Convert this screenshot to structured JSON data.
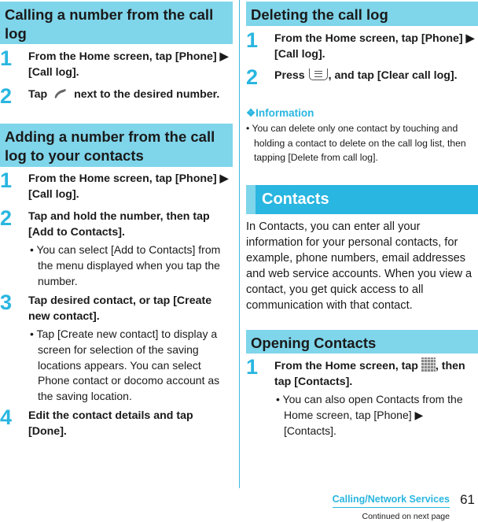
{
  "left": {
    "section1": {
      "title": "Calling a number from the call log",
      "steps": [
        {
          "num": "1",
          "text": "From the Home screen, tap [Phone] ▶ [Call log]."
        },
        {
          "num": "2",
          "text_before": "Tap",
          "icon": "phone-handset-icon",
          "text_after": "next to the desired number."
        }
      ]
    },
    "section2": {
      "title": "Adding a number from the call log to your contacts",
      "steps": [
        {
          "num": "1",
          "text": "From the Home screen, tap [Phone] ▶ [Call log]."
        },
        {
          "num": "2",
          "text": "Tap and hold the number, then tap [Add to Contacts].",
          "note": "You can select [Add to Contacts] from the menu displayed when you tap the number."
        },
        {
          "num": "3",
          "text": "Tap desired contact, or tap [Create new contact].",
          "note": "Tap [Create new contact] to display a screen for selection of the saving locations appears. You can select Phone contact or docomo account as the saving location."
        },
        {
          "num": "4",
          "text": "Edit the contact details and tap [Done]."
        }
      ]
    }
  },
  "right": {
    "section3": {
      "title": "Deleting the call log",
      "steps": [
        {
          "num": "1",
          "text": "From the Home screen, tap [Phone] ▶ [Call log]."
        },
        {
          "num": "2",
          "text_before": "Press",
          "icon": "menu-key-icon",
          "text_after": ", and tap [Clear call log]."
        }
      ],
      "info_title": "❖Information",
      "info_text": "You can delete only one contact by touching and holding a contact to delete on the call log list, then tapping [Delete from call log]."
    },
    "contacts": {
      "title": "Contacts",
      "paragraph": "In Contacts, you can enter all your information for your personal contacts, for example, phone numbers, email addresses and web service accounts. When you view a contact, you get quick access to all communication with that contact."
    },
    "section4": {
      "title": "Opening Contacts",
      "steps": [
        {
          "num": "1",
          "text_before": "From the Home screen, tap",
          "icon": "app-grid-icon",
          "text_after": ", then tap [Contacts].",
          "note": "You can also open Contacts from the Home screen, tap [Phone] ▶ [Contacts]."
        }
      ]
    }
  },
  "footer": {
    "chapter": "Calling/Network Services",
    "page": "61",
    "continued": "Continued on next page"
  },
  "colors": {
    "accent": "#29b6e0",
    "section_bg": "#7fd5ea"
  }
}
